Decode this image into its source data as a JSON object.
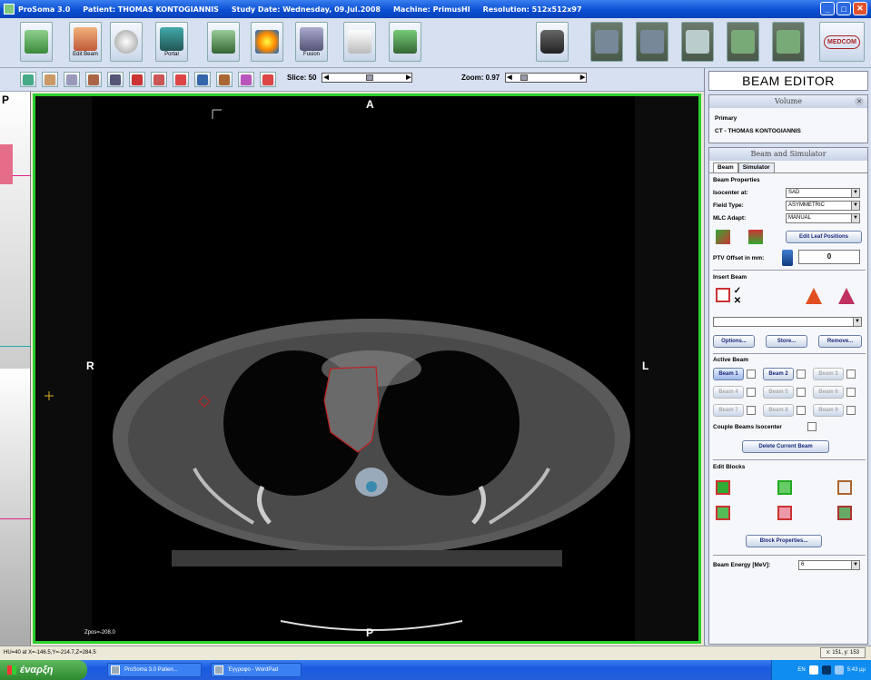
{
  "window": {
    "title_app": "ProSoma 3.0",
    "title_patient": "Patient: THOMAS KONTOGIANNIS",
    "title_study": "Study Date: Wednesday, 09.Jul.2008",
    "title_machine": "Machine: PrimusHI",
    "title_resolution": "Resolution: 512x512x97"
  },
  "toolbar": {
    "buttons": [
      {
        "name": "save",
        "label": ""
      },
      {
        "name": "edit-beam",
        "label": "Edit Beam"
      },
      {
        "name": "3d-view",
        "label": ""
      },
      {
        "name": "portal",
        "label": "Portal"
      },
      {
        "name": "contours",
        "label": ""
      },
      {
        "name": "dose",
        "label": ""
      },
      {
        "name": "fusion",
        "label": "Fusion"
      },
      {
        "name": "tools",
        "label": ""
      },
      {
        "name": "export",
        "label": ""
      }
    ],
    "layout_labels": [
      "",
      "",
      "",
      "",
      ""
    ],
    "logo_text": "MEDCOM"
  },
  "viewer_toolbar": {
    "slice_label": "Slice: 50",
    "zoom_label": "Zoom: 0.97"
  },
  "viewer": {
    "top": "A",
    "bottom": "P",
    "left": "R",
    "right": "L",
    "zpos": "Zpos=-208.0",
    "ruler_label": "P"
  },
  "panel": {
    "header": "BEAM EDITOR",
    "volume": {
      "title": "Volume",
      "primary": "Primary",
      "series": "CT - THOMAS KONTOGIANNIS"
    },
    "beam_sim": {
      "title": "Beam and Simulator",
      "tab_beam": "Beam",
      "tab_sim": "Simulator",
      "props_title": "Beam Properties",
      "isocenter_label": "Isocenter at:",
      "isocenter_value": "SAD",
      "fieldtype_label": "Field Type:",
      "fieldtype_value": "ASYMMETRIC",
      "mlc_label": "MLC Adapt:",
      "mlc_value": "MANUAL",
      "edit_leaf": "Edit Leaf Positions",
      "ptv_label": "PTV Offset in mm:",
      "ptv_value": "0",
      "insert_title": "Insert Beam",
      "options": "Options...",
      "store": "Store...",
      "remove": "Remove...",
      "active_title": "Active Beam",
      "beams": [
        "Beam 1",
        "Beam 2",
        "Beam 3",
        "Beam 4",
        "Beam 5",
        "Beam 6",
        "Beam 7",
        "Beam 8",
        "Beam 9"
      ],
      "couple_label": "Couple Beams Isocenter",
      "delete_beam": "Delete Current Beam",
      "edit_blocks_title": "Edit Blocks",
      "block_props": "Block Properties...",
      "energy_label": "Beam Energy [MeV]:",
      "energy_value": "6"
    }
  },
  "statusbar": {
    "left": "HU=40 at X=-146.5,Y=-214.7,Z=284.5",
    "right": "x: 151, y: 153"
  },
  "taskbar": {
    "start": "έναρξη",
    "tasks": [
      "ProSoma 3.0  Patien...",
      "Έγγραφο - WordPad"
    ],
    "lang": "EN",
    "clock": "5:43 μμ"
  }
}
